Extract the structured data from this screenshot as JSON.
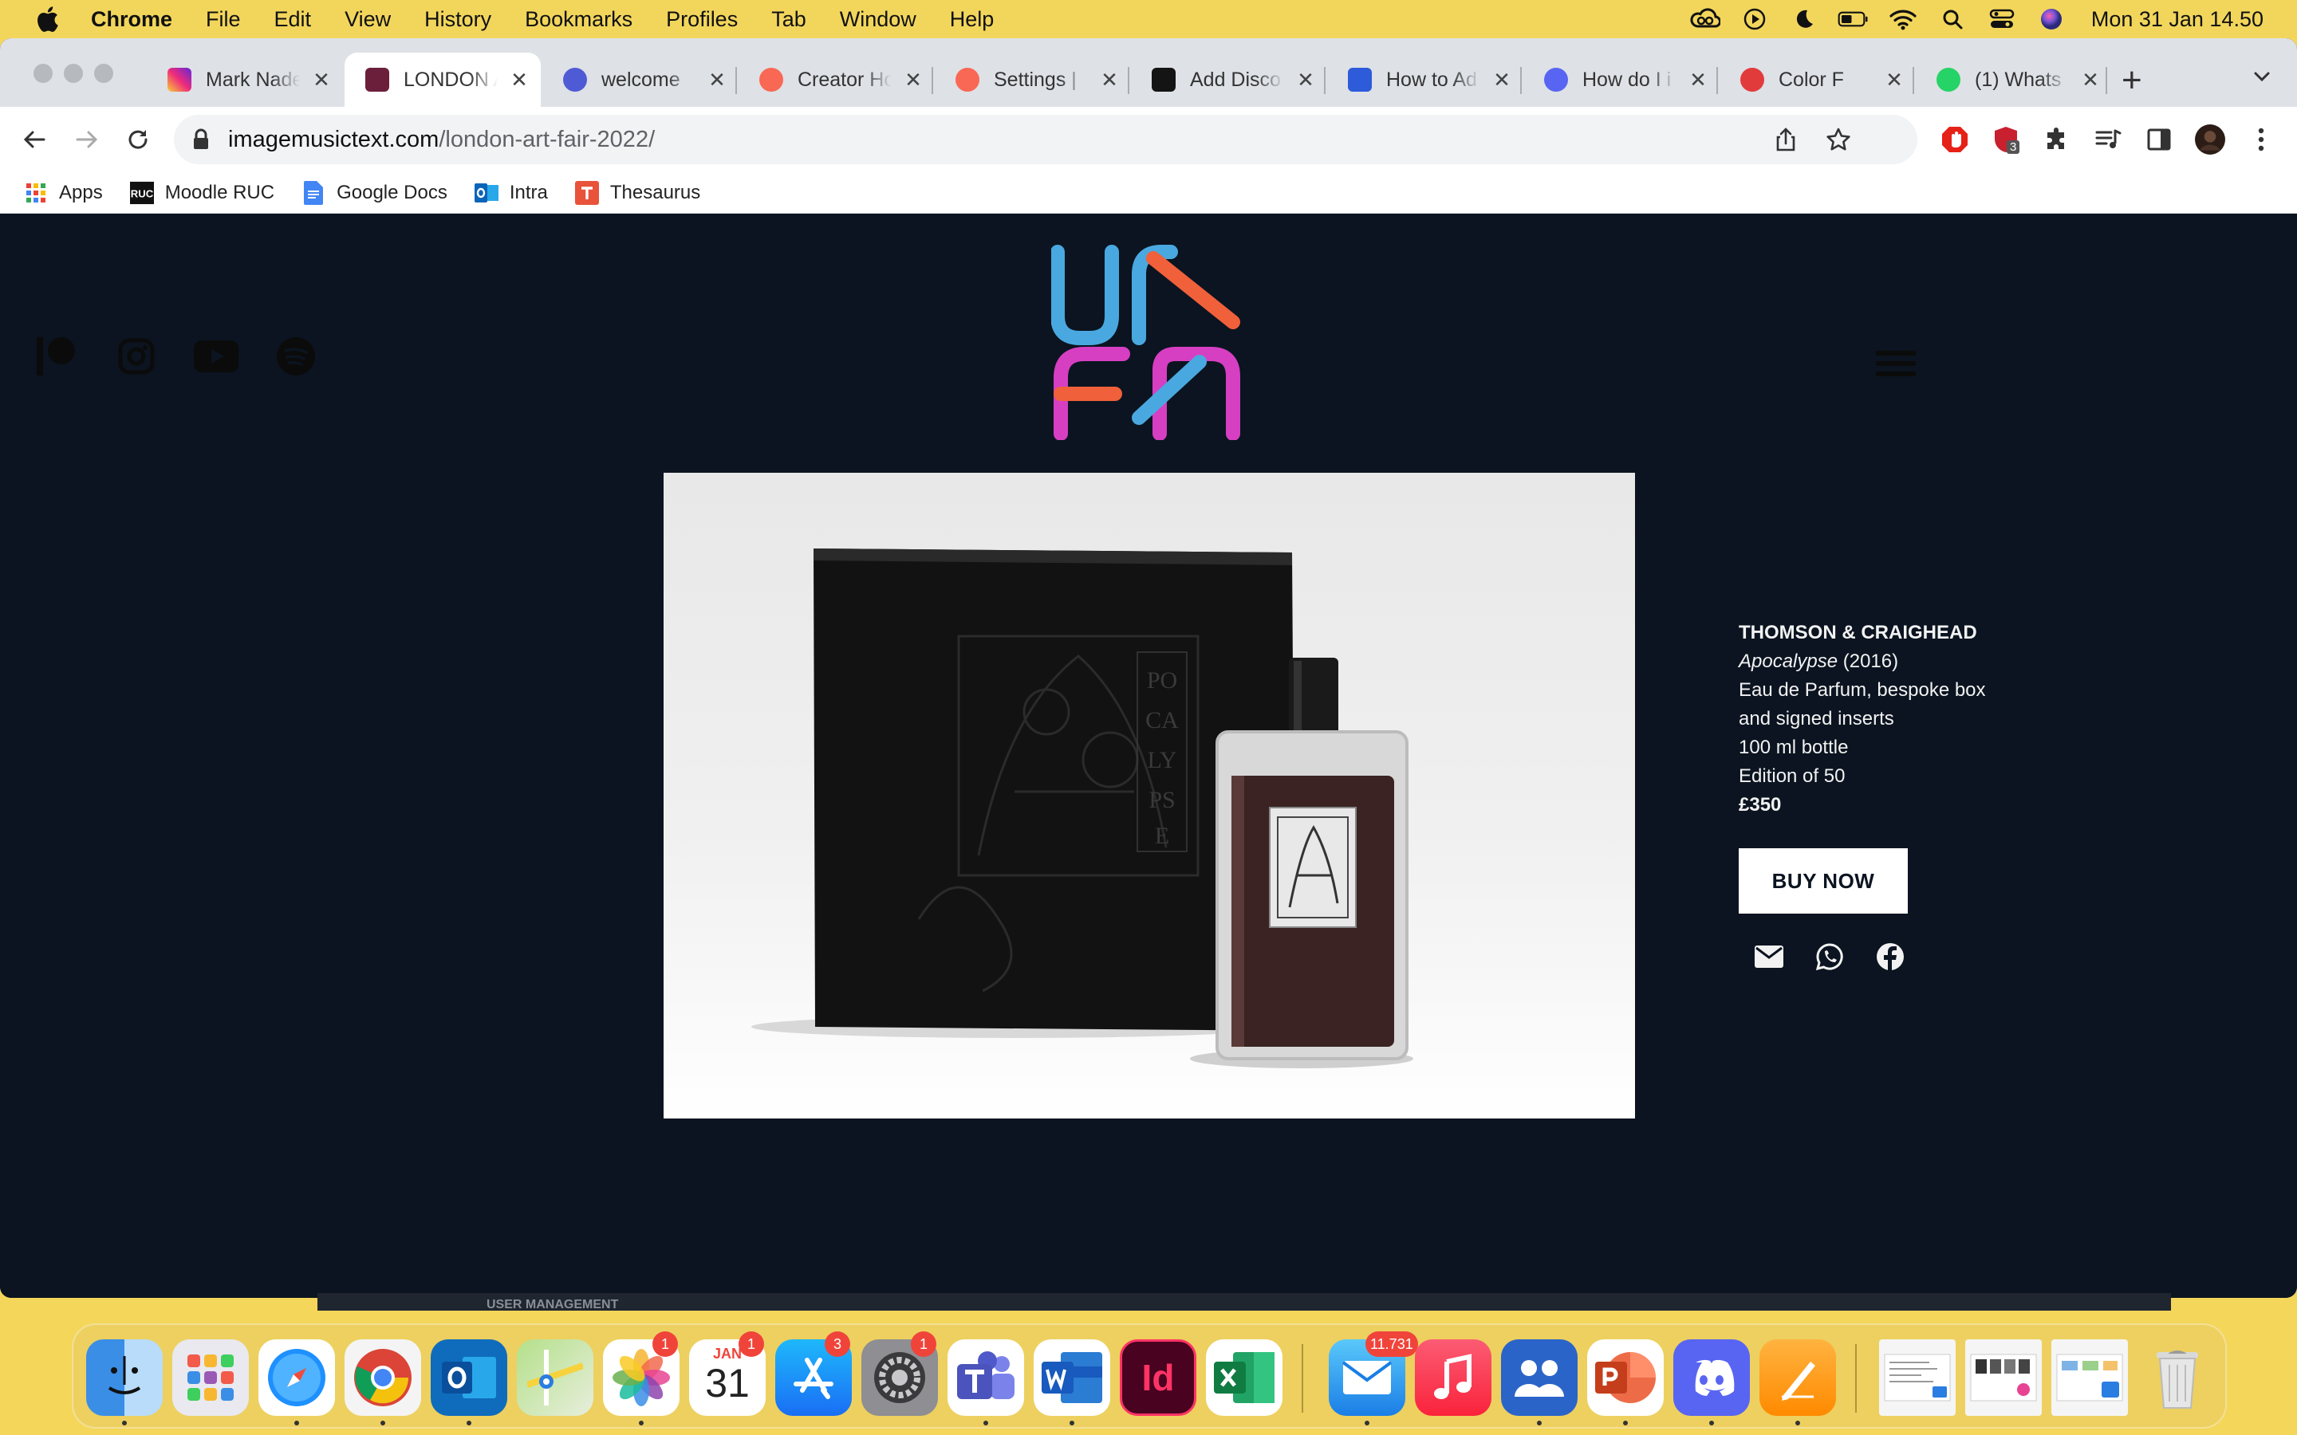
{
  "menubar": {
    "app_name": "Chrome",
    "menus": [
      "File",
      "Edit",
      "View",
      "History",
      "Bookmarks",
      "Profiles",
      "Tab",
      "Window",
      "Help"
    ],
    "clock": "Mon 31 Jan  14.50"
  },
  "tabs": [
    {
      "label": "Mark Nade",
      "color": "#d6249f"
    },
    {
      "label": "LONDON A",
      "color": "#6b1f3a"
    },
    {
      "label": "welcome",
      "color": "#4f5bd5"
    },
    {
      "label": "Creator Ho",
      "color": "#f96854"
    },
    {
      "label": "Settings |",
      "color": "#f96854"
    },
    {
      "label": "Add Disco",
      "color": "#141414"
    },
    {
      "label": "How to Ad",
      "color": "#2d5bd9"
    },
    {
      "label": "How do I i",
      "color": "#5865f2"
    },
    {
      "label": "Color F",
      "color": "#e23b3b"
    },
    {
      "label": "(1) Whats",
      "color": "#25d366"
    }
  ],
  "tab_close_glyph": "✕",
  "new_tab_glyph": "+",
  "omnibox": {
    "domain": "imagemusictext.com",
    "path": "/london-art-fair-2022/"
  },
  "bookmarks": [
    {
      "label": "Apps",
      "icon": "apps-grid-icon"
    },
    {
      "label": "Moodle RUC",
      "icon": "ruc-icon"
    },
    {
      "label": "Google Docs",
      "icon": "google-docs-icon"
    },
    {
      "label": "Intra",
      "icon": "outlook-icon"
    },
    {
      "label": "Thesaurus",
      "icon": "thesaurus-icon"
    }
  ],
  "extensions": {
    "badge_count": "3"
  },
  "product": {
    "artist": "THOMSON & CRAIGHEAD",
    "title": "Apocalypse",
    "year": " (2016)",
    "description_line1": "Eau de Parfum, bespoke box",
    "description_line2": "and signed inserts",
    "volume": "100 ml bottle",
    "edition": "Edition of 50",
    "price": "£350",
    "buy_label": "BUY NOW"
  },
  "artwork": {
    "box_letters": [
      "PO",
      "CA",
      "LY",
      "PS",
      "E"
    ]
  },
  "dock": {
    "calendar_month": "JAN",
    "calendar_day": "31",
    "badges": {
      "photos": "1",
      "calendar": "1",
      "appstore": "3",
      "settings": "1",
      "mail": "11.731"
    },
    "behind_text": "USER MANAGEMENT"
  },
  "colors": {
    "page_bg": "#0b1420",
    "logo_blue": "#4aa8e0",
    "logo_orange": "#f0603a",
    "logo_magenta": "#d63fc2"
  }
}
